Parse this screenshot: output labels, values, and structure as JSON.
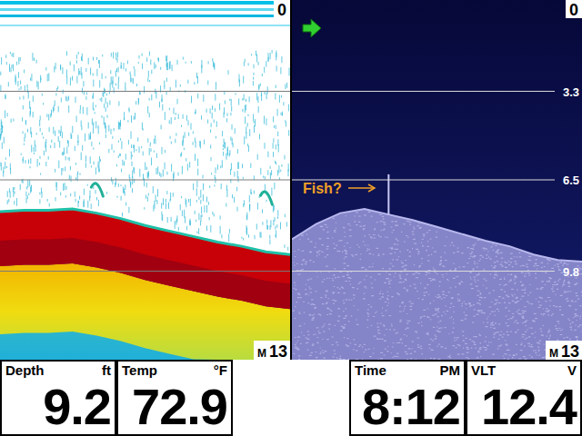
{
  "sonar_view": {
    "depth_top": "0",
    "mode": "M",
    "range": "13",
    "grid_depths": [
      3.3,
      6.5,
      9.8
    ],
    "bottom_depths": [
      7.65,
      7.6,
      7.6,
      7.55,
      7.7,
      7.9,
      8.15,
      8.35,
      8.55,
      8.75,
      8.9,
      9.1,
      9.2
    ],
    "targets": [
      {
        "sample": 4,
        "depth": 6.7
      },
      {
        "sample": 11,
        "depth": 7.0
      }
    ]
  },
  "down_imaging_view": {
    "depth_top": "0",
    "mode": "M",
    "range": "13",
    "depth_lines": [
      "3.3",
      "6.5",
      "9.8"
    ],
    "bottom_depths": [
      8.65,
      8.1,
      7.7,
      7.55,
      7.75,
      7.95,
      8.2,
      8.45,
      8.7,
      8.9,
      9.2,
      9.4,
      9.45
    ],
    "targets": [
      {
        "sample": 4,
        "depth": 6.3
      }
    ],
    "annotation": "Fish?"
  },
  "readouts": [
    {
      "label": "Depth",
      "unit": "ft",
      "value": "9.2"
    },
    {
      "label": "Temp",
      "unit": "°F",
      "value": "72.9"
    },
    {
      "label": "Time",
      "unit": "PM",
      "value": "8:12"
    },
    {
      "label": "VLT",
      "unit": "V",
      "value": "12.4"
    }
  ]
}
